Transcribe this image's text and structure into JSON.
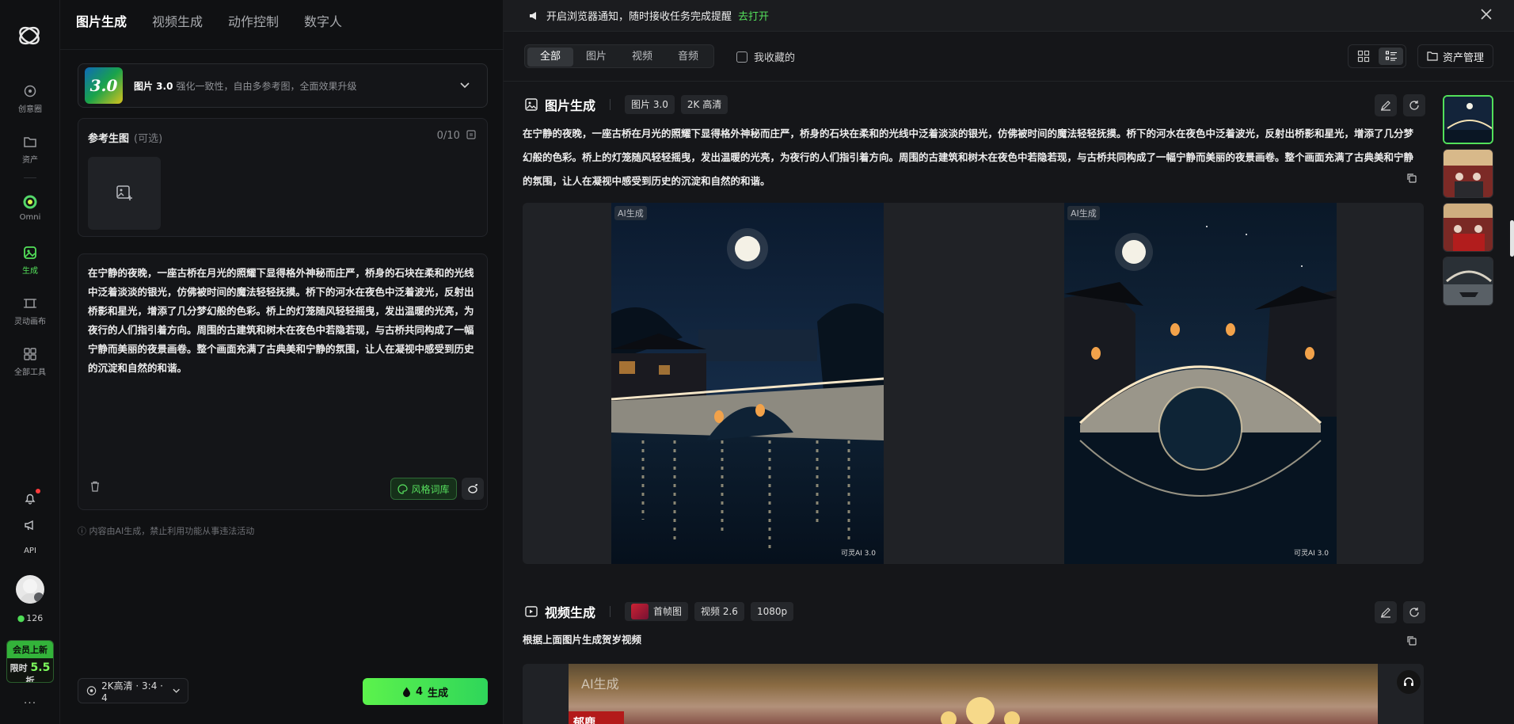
{
  "rail": {
    "items": [
      {
        "label": "创意圈",
        "icon": "compass-icon"
      },
      {
        "label": "资产",
        "icon": "folder-icon"
      },
      {
        "label": "Omni",
        "icon": "omni-icon"
      },
      {
        "label": "生成",
        "icon": "image-generate-icon"
      },
      {
        "label": "灵动画布",
        "icon": "canvas-icon"
      },
      {
        "label": "全部工具",
        "icon": "grid-icon"
      }
    ],
    "api_label": "API",
    "credits": "126",
    "vip_top": "会员上新",
    "vip_prefix": "限时",
    "vip_value": "5.5",
    "vip_suffix": "折",
    "more": "..."
  },
  "panel": {
    "tabs": [
      "图片生成",
      "视频生成",
      "动作控制",
      "数字人"
    ],
    "active_tab": 0,
    "model": {
      "badge": "3.0",
      "name": "图片 3.0",
      "desc": "强化一致性，自由多参考图，全面效果升级"
    },
    "reference": {
      "title": "参考生图",
      "optional": "(可选)",
      "count": "0/10"
    },
    "prompt": "在宁静的夜晚，一座古桥在月光的照耀下显得格外神秘而庄严，桥身的石块在柔和的光线中泛着淡淡的银光，仿佛被时间的魔法轻轻抚摸。桥下的河水在夜色中泛着波光，反射出桥影和星光，增添了几分梦幻般的色彩。桥上的灯笼随风轻轻摇曳，发出温暖的光亮，为夜行的人们指引着方向。周围的古建筑和树木在夜色中若隐若现，与古桥共同构成了一幅宁静而美丽的夜景画卷。整个画面充满了古典美和宁静的氛围，让人在凝视中感受到历史的沉淀和自然的和谐。",
    "style_button": "风格词库",
    "disclaimer": "内容由AI生成，禁止利用功能从事违法活动",
    "settings": "2K高清 · 3:4 · 4",
    "generate_cost": "4",
    "generate_label": "生成"
  },
  "main": {
    "notice": {
      "text": "开启浏览器通知，随时接收任务完成提醒",
      "link": "去打开"
    },
    "filters": [
      "全部",
      "图片",
      "视频",
      "音频"
    ],
    "active_filter": 0,
    "favorites_label": "我收藏的",
    "asset_button": "资产管理",
    "image_section": {
      "title": "图片生成",
      "chips": [
        "图片 3.0",
        "2K 高清"
      ],
      "desc": "在宁静的夜晚，一座古桥在月光的照耀下显得格外神秘而庄严，桥身的石块在柔和的光线中泛着淡淡的银光，仿佛被时间的魔法轻轻抚摸。桥下的河水在夜色中泛着波光，反射出桥影和星光，增添了几分梦幻般的色彩。桥上的灯笼随风轻轻摇曳，发出温暖的光亮，为夜行的人们指引着方向。周围的古建筑和树木在夜色中若隐若现，与古桥共同构成了一幅宁静而美丽的夜景画卷。整个画面充满了古典美和宁静的氛围，让人在凝视中感受到历史的沉淀和自然的和谐。",
      "ai_tag": "AI生成",
      "watermark": "可灵AI 3.0"
    },
    "video_section": {
      "title": "视频生成",
      "chips": [
        "首帧图",
        "视频 2.6",
        "1080p"
      ],
      "desc": "根据上面图片生成贺岁视频",
      "ai_tag": "AI生成",
      "sign_text": "郁鹿"
    }
  },
  "colors": {
    "accent": "#53e05a",
    "background": "#0d0e10",
    "panel": "#101113"
  }
}
